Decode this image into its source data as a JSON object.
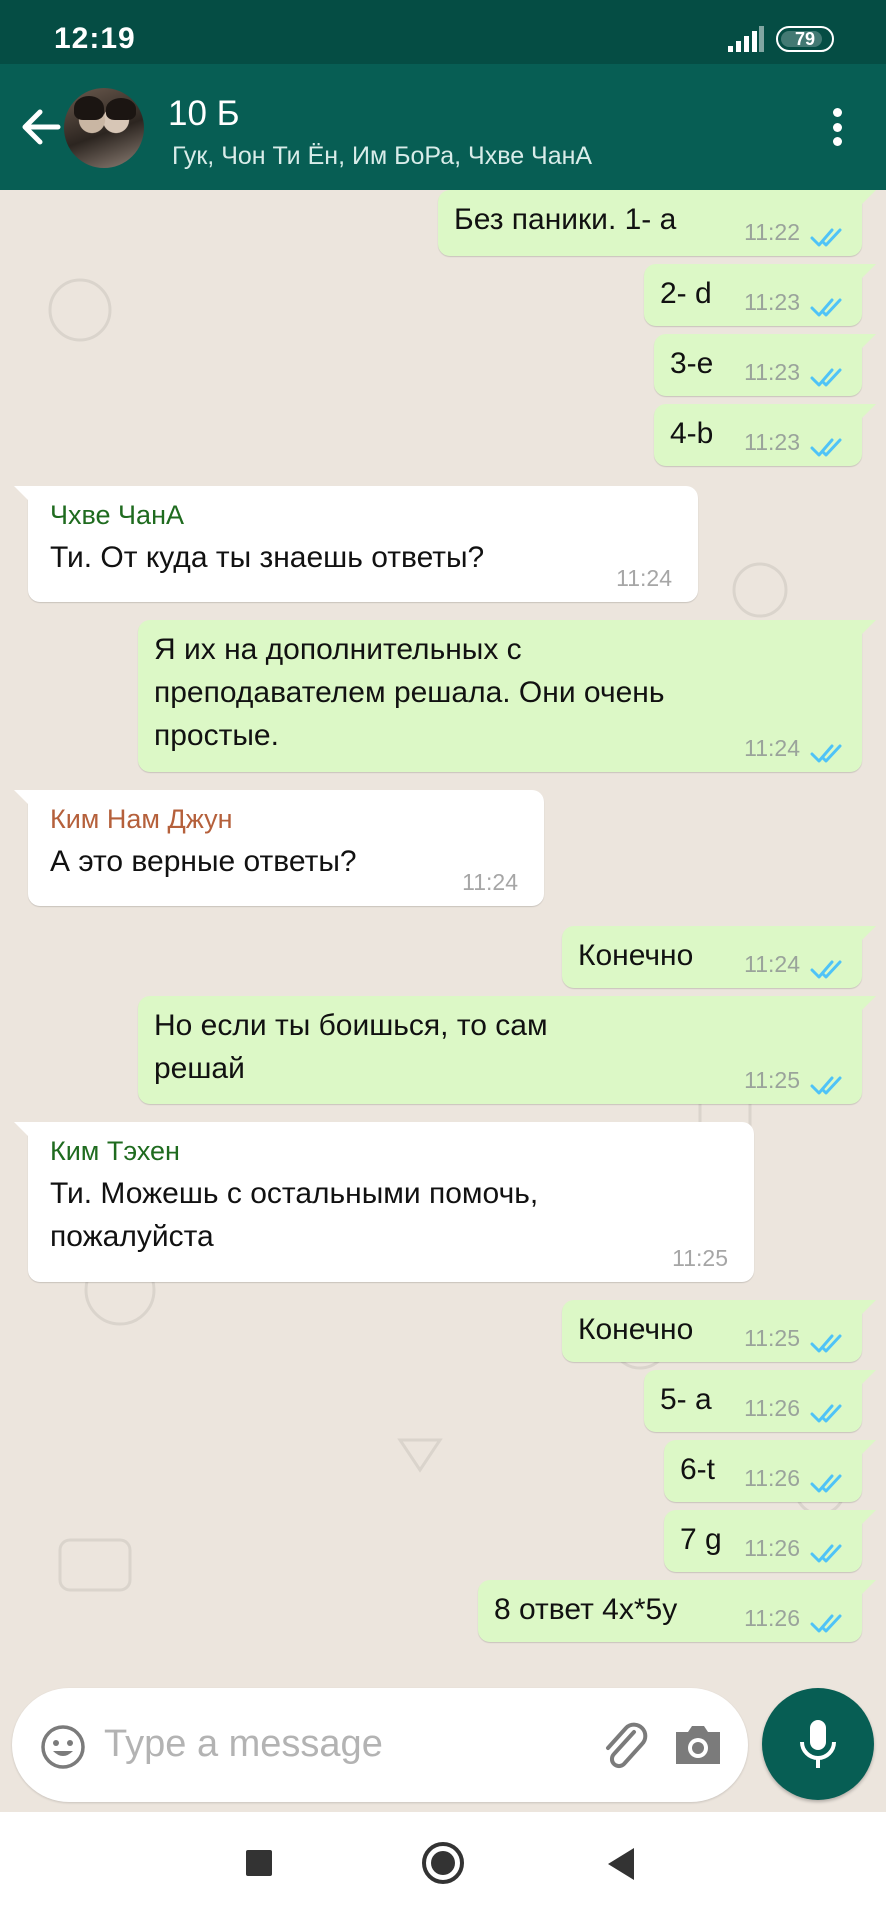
{
  "status_bar": {
    "time": "12:19",
    "battery": "79"
  },
  "header": {
    "title": "10 Б",
    "members": "Гук, Чон Ти Ён, Им БоРа, Чхве ЧанА",
    "icons": {
      "back": "arrow-left-icon",
      "menu": "more-vertical-icon"
    }
  },
  "messages": [
    {
      "dir": "out",
      "text": "Без паники. 1- а",
      "time": "11:22"
    },
    {
      "dir": "out",
      "text": "2- d",
      "time": "11:23"
    },
    {
      "dir": "out",
      "text": "3-e",
      "time": "11:23"
    },
    {
      "dir": "out",
      "text": "4-b",
      "time": "11:23"
    },
    {
      "dir": "in",
      "sender": "Чхве ЧанА",
      "sender_color": "#1f6b1f",
      "text": "Ти. От куда ты знаешь ответы?",
      "time": "11:24"
    },
    {
      "dir": "out",
      "text": "Я их на дополнительных с\nпреподавателем решала. Они очень\nпростые.",
      "time": "11:24"
    },
    {
      "dir": "in",
      "sender": "Ким Нам Джун",
      "sender_color": "#b5603b",
      "text": "А это верные ответы?",
      "time": "11:24"
    },
    {
      "dir": "out",
      "text": "Конечно",
      "time": "11:24"
    },
    {
      "dir": "out",
      "text": "Но если ты боишься, то сам\nрешай",
      "time": "11:25"
    },
    {
      "dir": "in",
      "sender": "Ким Тэхен",
      "sender_color": "#1f6b1f",
      "text": "Ти. Можешь с остальными помочь,\nпожалуйста",
      "time": "11:25"
    },
    {
      "dir": "out",
      "text": "Конечно",
      "time": "11:25"
    },
    {
      "dir": "out",
      "text": "5- а",
      "time": "11:26"
    },
    {
      "dir": "out",
      "text": "6-t",
      "time": "11:26"
    },
    {
      "dir": "out",
      "text": "7 g",
      "time": "11:26"
    },
    {
      "dir": "out",
      "text": "8 ответ 4x*5y",
      "time": "11:26"
    }
  ],
  "input": {
    "placeholder": "Type a message"
  },
  "colors": {
    "header": "#075E54",
    "status_bar": "#054D44",
    "outgoing": "#DCF8C6",
    "incoming": "#FFFFFF",
    "read_ticks": "#4FC3F7",
    "chat_bg": "#ECE5DD"
  }
}
